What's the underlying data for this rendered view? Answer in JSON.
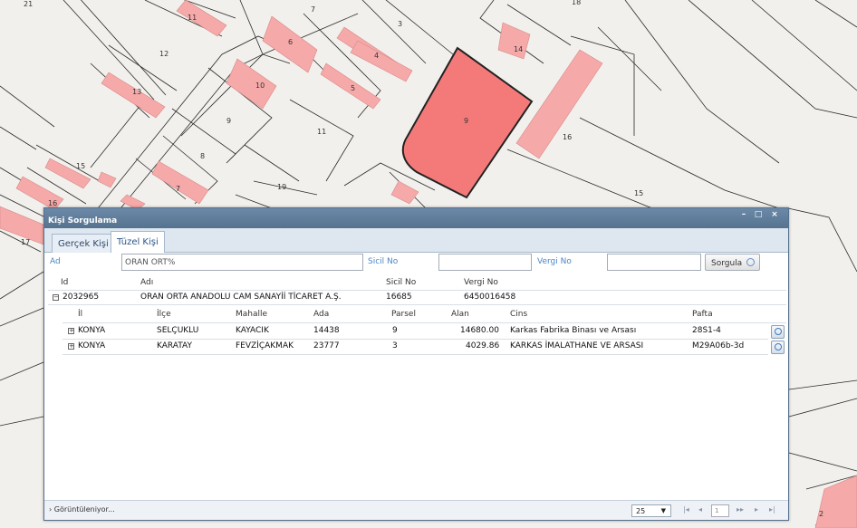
{
  "map": {
    "labels": [
      "21",
      "11",
      "7",
      "3",
      "18",
      "6",
      "4",
      "14",
      "12",
      "10",
      "5",
      "13",
      "9",
      "9",
      "16",
      "11",
      "8",
      "15",
      "19",
      "15",
      "16",
      "7",
      "17",
      "2"
    ]
  },
  "dialog": {
    "title": "Kişi Sorgulama",
    "tabs": [
      {
        "label": "Gerçek Kişi"
      },
      {
        "label": "Tüzel Kişi"
      }
    ],
    "filter": {
      "ad_label": "Ad",
      "ad_value": "ORAN ORT%",
      "sicil_label": "Sicil No",
      "sicil_value": "",
      "vergi_label": "Vergi No",
      "vergi_value": "",
      "search_label": "Sorgula"
    },
    "owner_headers": {
      "id": "Id",
      "adi": "Adı",
      "sicil": "Sicil No",
      "vergi": "Vergi No"
    },
    "owner": {
      "id": "2032965",
      "adi": "ORAN ORTA ANADOLU CAM SANAYİİ TİCARET A.Ş.",
      "sicil": "16685",
      "vergi": "6450016458"
    },
    "parcel_headers": {
      "il": "İl",
      "ilce": "İlçe",
      "mahalle": "Mahalle",
      "ada": "Ada",
      "parsel": "Parsel",
      "alan": "Alan",
      "cins": "Cins",
      "pafta": "Pafta"
    },
    "parcels": [
      {
        "il": "KONYA",
        "ilce": "SELÇUKLU",
        "mahalle": "KAYACIK",
        "ada": "14438",
        "parsel": "9",
        "alan": "14680.00",
        "cins": "Karkas Fabrika Binası ve Arsası",
        "pafta": "28S1-4"
      },
      {
        "il": "KONYA",
        "ilce": "KARATAY",
        "mahalle": "FEVZİÇAKMAK",
        "ada": "23777",
        "parsel": "3",
        "alan": "4029.86",
        "cins": "KARKAS İMALATHANE VE ARSASI",
        "pafta": "M29A06b-3d"
      }
    ],
    "footer": {
      "status": "Görüntüleniyor...",
      "page_size": "25",
      "page": "1"
    }
  },
  "colors": {
    "highlight_parcel": "#f47a7a",
    "building": "#f5a9a9",
    "titlebar": "#5f7d9b"
  }
}
